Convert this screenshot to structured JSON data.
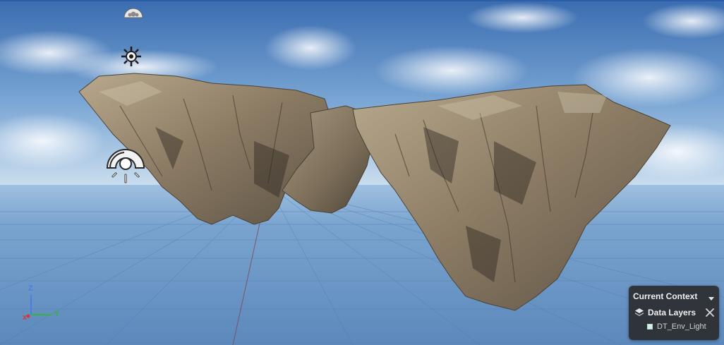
{
  "viewport": {
    "axis_gizmo": {
      "z_label": "Z",
      "y_label": "Y",
      "x_label": "x"
    },
    "icons": {
      "skylight": "sky-light-icon",
      "sun": "directional-light-icon",
      "lamp": "point-light-icon"
    }
  },
  "context_panel": {
    "title": "Current Context",
    "data_layers_label": "Data Layers",
    "layer_item_label": "DT_Env_Light",
    "layer_swatch_color": "#d6efe6"
  },
  "colors": {
    "sky_top": "#3b6eb2",
    "sky_horizon": "#cfe0ee",
    "ground": "#6f9bc9",
    "grid_line": "#4f7bb0"
  }
}
